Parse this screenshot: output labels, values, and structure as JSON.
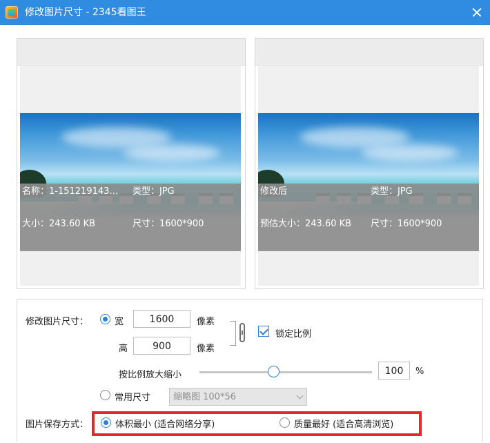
{
  "window": {
    "title": "修改图片尺寸 - 2345看图王"
  },
  "original": {
    "name_label": "名称：1-151219143…",
    "type_label": "类型：JPG",
    "size_label": "大小：243.60 KB",
    "dim_label": "尺寸：1600*900"
  },
  "modified": {
    "name_label": "修改后",
    "type_label": "类型：JPG",
    "size_label": "预估大小：243.60 KB",
    "dim_label": "尺寸：1600*900"
  },
  "resize": {
    "label": "修改图片尺寸：",
    "width_label": "宽",
    "width_value": "1600",
    "width_unit": "像素",
    "height_label": "高",
    "height_value": "900",
    "height_unit": "像素",
    "lock_label": "锁定比例",
    "scale_label": "按比例放大缩小",
    "scale_value": "100",
    "scale_unit": "%",
    "common_label": "常用尺寸",
    "common_select": "缩略图 100*56"
  },
  "save": {
    "label": "图片保存方式：",
    "option_small": "体积最小 (适合网络分享)",
    "option_quality": "质量最好 (适合高清浏览)"
  },
  "colors": {
    "accent": "#2f7fd6",
    "titlebar": "#2f8ce1",
    "highlight": "#e02a2a"
  }
}
